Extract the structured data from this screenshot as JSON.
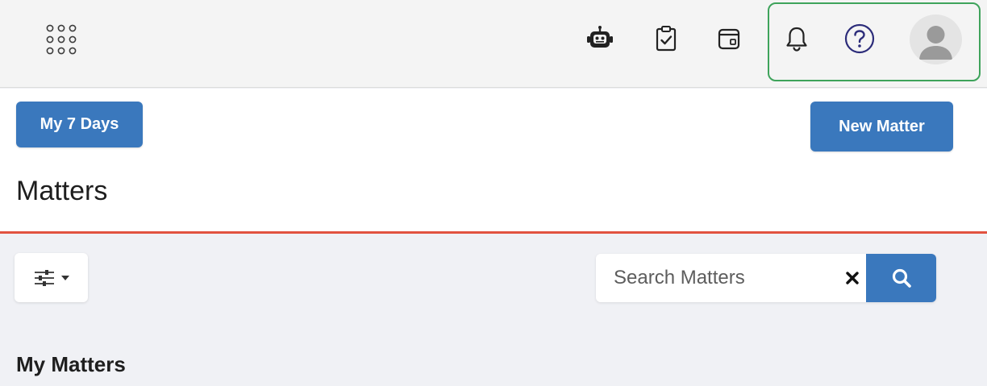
{
  "header": {
    "icons": [
      {
        "name": "app-launcher-icon"
      },
      {
        "name": "robot-assistant-icon"
      },
      {
        "name": "clipboard-check-icon"
      },
      {
        "name": "calendar-icon"
      },
      {
        "name": "bell-icon"
      },
      {
        "name": "help-icon"
      },
      {
        "name": "user-avatar-icon"
      }
    ],
    "highlight_color": "#3ea35b"
  },
  "actions": {
    "my_7_days_label": "My 7 Days",
    "new_matter_label": "New Matter"
  },
  "page": {
    "title": "Matters",
    "accent_line_color": "#e2523f"
  },
  "toolbar": {
    "filter_icon": "sliders-icon",
    "search": {
      "placeholder": "Search Matters",
      "value": ""
    }
  },
  "sections": {
    "my_matters_heading": "My Matters"
  },
  "colors": {
    "primary": "#3a78bd",
    "background": "#f0f1f5",
    "header_bg": "#f4f4f4"
  }
}
